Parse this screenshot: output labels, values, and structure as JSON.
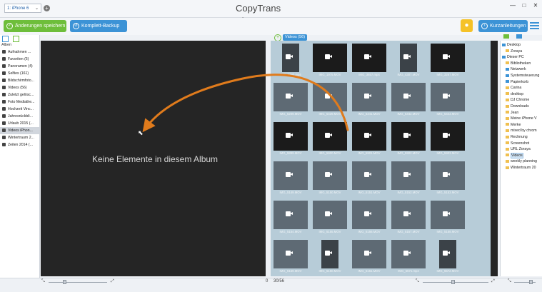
{
  "app": {
    "title": "CopyTrans Photo"
  },
  "device": {
    "selected": "1: iPhone 6",
    "add_label": "+"
  },
  "window": {
    "minimize": "—",
    "maximize": "□",
    "close": "✕"
  },
  "toolbar": {
    "save_label": "Änderungen speichern",
    "backup_label": "Komplett-Backup",
    "guides_label": "Kurzanleitungen"
  },
  "albums": {
    "header": "Alben",
    "items": [
      {
        "label": "Aufnahmen ..."
      },
      {
        "label": "Favoriten (5)"
      },
      {
        "label": "Panoramen (4)"
      },
      {
        "label": "Selfies (161)"
      },
      {
        "label": "Bildschirmfoto..."
      },
      {
        "label": "Videos (56)"
      },
      {
        "label": "Zuletzt gelösc..."
      },
      {
        "label": "Foto Mediathe..."
      },
      {
        "label": "Hochzeit Vinc..."
      },
      {
        "label": "Jahresrückbli..."
      },
      {
        "label": "Urlaub 2015 (..."
      },
      {
        "label": "Videos iPhon..."
      },
      {
        "label": "Wintertraum 2..."
      },
      {
        "label": "Zeiten 2014 (..."
      }
    ]
  },
  "drop_pane": {
    "empty_message": "Keine Elemente in diesem Album"
  },
  "media": {
    "album_tab": "Videos (56)",
    "add_icon": "+",
    "captions": [
      "IMG_1780.mp4",
      "IMG_1975.MOV",
      "IMG_3657.mp4",
      "IMG_4307.MOV",
      "IMG_3267.MOV",
      "IMG_5209.MOV",
      "IMG_5439.MOV",
      "IMG_5441.MOV",
      "IMG_5442.MOV",
      "IMG_5443.MOV",
      "IMG_5899.MOV",
      "IMG_5900.MOV",
      "IMG_5901.MOV",
      "IMG_5902.MOV",
      "IMG_5903.MOV",
      "IMG_5149.MOV",
      "IMG_5150.MOV",
      "IMG_5151.MOV",
      "IMG_5152.MOV",
      "IMG_5153.MOV",
      "IMG_5154.MOV",
      "IMG_5155.MOV",
      "IMG_5156.MOV",
      "IMG_5157.MOV",
      "IMG_5158.MOV",
      "IMG_5159.MOV",
      "IMG_5160.MOV",
      "IMG_5161.MOV",
      "IMG_5571.mp4",
      "IMG_5572.MOV"
    ]
  },
  "tree": {
    "items": [
      {
        "label": "Desktop",
        "icon": "blue"
      },
      {
        "label": "Zoraya",
        "icon": "folder"
      },
      {
        "label": "Dieser PC",
        "icon": "blue"
      },
      {
        "label": "Bibliotheken",
        "icon": "folder"
      },
      {
        "label": "Netzwerk",
        "icon": "blue"
      },
      {
        "label": "Systemsteuerung",
        "icon": "blue"
      },
      {
        "label": "Papierkorb",
        "icon": "blue"
      },
      {
        "label": "Carina",
        "icon": "folder"
      },
      {
        "label": "desktop",
        "icon": "folder"
      },
      {
        "label": "DJ Chrome",
        "icon": "folder"
      },
      {
        "label": "Downloads",
        "icon": "folder"
      },
      {
        "label": "Jean",
        "icon": "folder"
      },
      {
        "label": "Meine iPhone V",
        "icon": "folder"
      },
      {
        "label": "Merke",
        "icon": "folder"
      },
      {
        "label": "mixed by chrom",
        "icon": "folder"
      },
      {
        "label": "Rechnung",
        "icon": "folder"
      },
      {
        "label": "Screenshot",
        "icon": "folder"
      },
      {
        "label": "URL Zoraya",
        "icon": "folder"
      },
      {
        "label": "Videos",
        "icon": "folder"
      },
      {
        "label": "weekly planning",
        "icon": "folder"
      },
      {
        "label": "Wintertraum 20",
        "icon": "folder"
      }
    ]
  },
  "status": {
    "left_count": "0",
    "right_count": "30/56"
  },
  "colors": {
    "accent_blue": "#3c93d6",
    "save_green": "#6ebe3b",
    "arrow_orange": "#e07b1c"
  }
}
